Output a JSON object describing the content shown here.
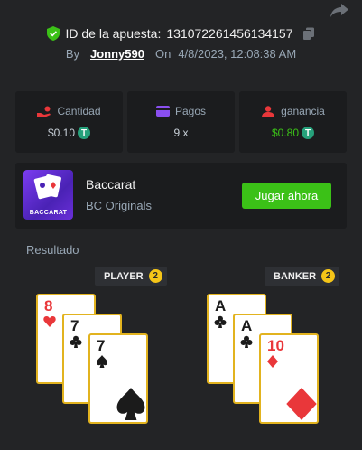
{
  "header": {
    "bet_id_label": "ID de la apuesta:",
    "bet_id": "131072261456134157",
    "by_label": "By",
    "username": "Jonny590",
    "on_label": "On",
    "datetime": "4/8/2023, 12:08:38 AM"
  },
  "stats": [
    {
      "label": "Cantidad",
      "value": "$0.10",
      "icon": "hand-coins-icon",
      "currency": "T"
    },
    {
      "label": "Pagos",
      "value": "9 x",
      "icon": "wallet-icon"
    },
    {
      "label": "ganancia",
      "value": "$0.80",
      "icon": "profit-icon",
      "currency": "T",
      "color": "#3bc117"
    }
  ],
  "game": {
    "name": "Baccarat",
    "provider": "BC Originals",
    "thumb_text": "BACCARAT",
    "play_label": "Jugar ahora"
  },
  "result": {
    "label": "Resultado",
    "player": {
      "label": "PLAYER",
      "score": "2",
      "cards": [
        {
          "rank": "8",
          "suit": "hearts"
        },
        {
          "rank": "7",
          "suit": "clubs"
        },
        {
          "rank": "7",
          "suit": "spades"
        }
      ]
    },
    "banker": {
      "label": "BANKER",
      "score": "2",
      "cards": [
        {
          "rank": "A",
          "suit": "clubs"
        },
        {
          "rank": "A",
          "suit": "clubs"
        },
        {
          "rank": "10",
          "suit": "diamonds"
        }
      ]
    }
  },
  "colors": {
    "background": "#232426",
    "panel": "#1b1c1e",
    "accent_green": "#3bc117",
    "card_border": "#e2b31f",
    "score_badge": "#f5c518"
  }
}
